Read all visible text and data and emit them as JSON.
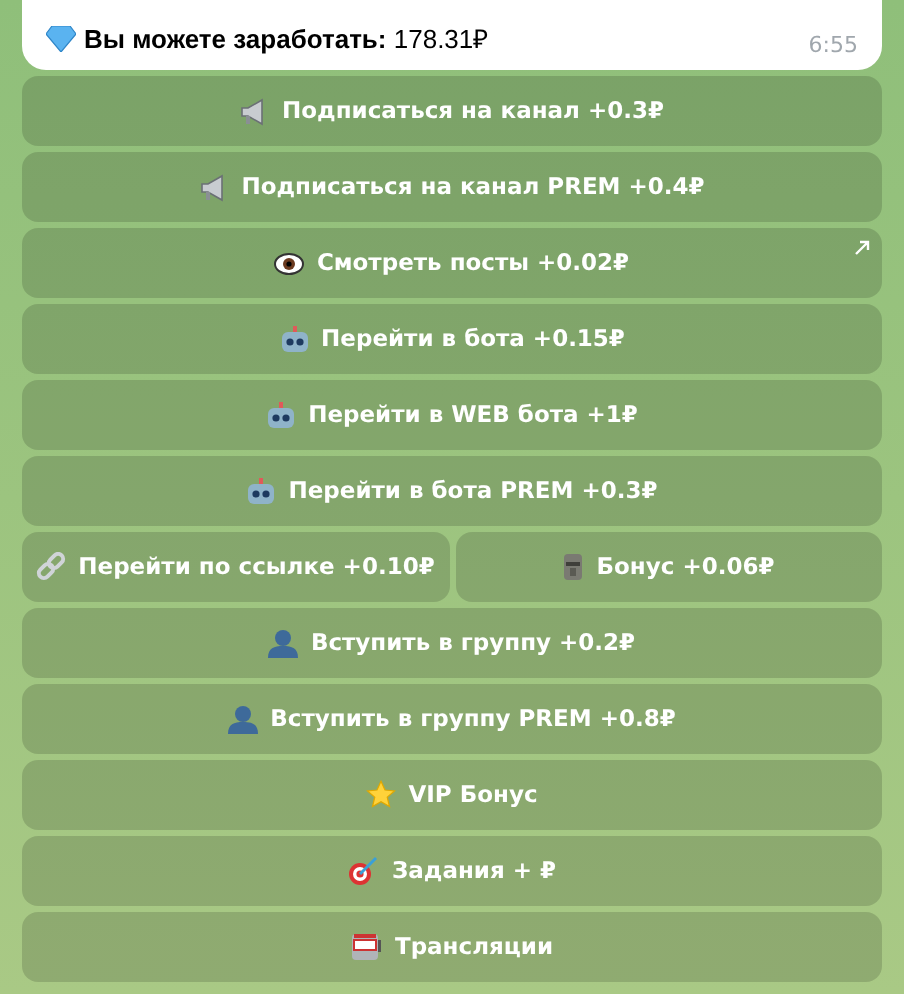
{
  "message": {
    "text": "**Вы можете заработать:** 178.31₽",
    "time": "6:55"
  },
  "keyboard": [
    [
      {
        "label": "Подписаться на канал +0.3₽",
        "kind": "callback"
      }
    ],
    [
      {
        "label": "Подписаться на канал PREM +0.4₽",
        "kind": "callback"
      }
    ],
    [
      {
        "label": "Смотреть посты +0.02₽",
        "kind": "url"
      }
    ],
    [
      {
        "label": "Перейти в бота +0.15₽",
        "kind": "callback"
      }
    ],
    [
      {
        "label": "Перейти в WEB бота +1₽",
        "kind": "callback"
      }
    ],
    [
      {
        "label": "Перейти в бота PREM +0.3₽",
        "kind": "callback"
      }
    ],
    [
      {
        "label": "Перейти по ссылке +0.10₽",
        "kind": "callback"
      },
      {
        "label": "Бонус +0.06₽",
        "kind": "callback"
      }
    ],
    [
      {
        "label": "Вступить в группу +0.2₽",
        "kind": "callback"
      }
    ],
    [
      {
        "label": "Вступить в группу PREM +0.8₽",
        "kind": "callback"
      }
    ],
    [
      {
        "label": "VIP Бонус",
        "kind": "callback"
      }
    ],
    [
      {
        "label": "Задания + ₽",
        "kind": "callback"
      }
    ],
    [
      {
        "label": "Трансляции",
        "kind": "callback"
      }
    ]
  ]
}
